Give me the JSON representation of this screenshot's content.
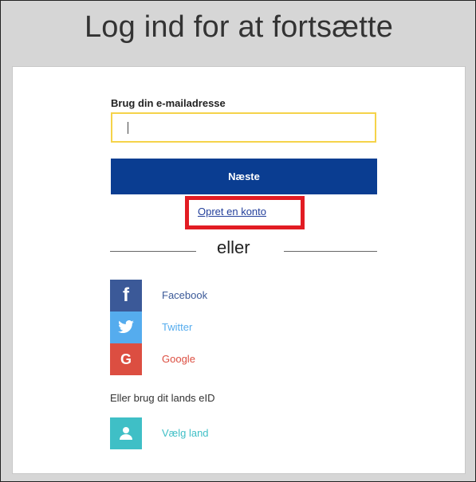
{
  "header": {
    "title": "Log ind for at fortsætte"
  },
  "login": {
    "email_label": "Brug din e-mailadresse",
    "email_value": "",
    "next_label": "Næste",
    "create_account_label": "Opret en konto",
    "divider_text": "eller"
  },
  "social": {
    "items": [
      {
        "label": "Facebook",
        "icon": "facebook-icon",
        "color": "#3b5998"
      },
      {
        "label": "Twitter",
        "icon": "twitter-icon",
        "color": "#55acee"
      },
      {
        "label": "Google",
        "icon": "google-icon",
        "color": "#dc4e41"
      }
    ]
  },
  "eid": {
    "text": "Eller brug dit lands eID",
    "country_label": "Vælg land",
    "icon": "user-icon",
    "color": "#3fbfc6"
  },
  "colors": {
    "primary": "#0a3d91",
    "input_border": "#f5d34a",
    "highlight": "#e21c23"
  }
}
